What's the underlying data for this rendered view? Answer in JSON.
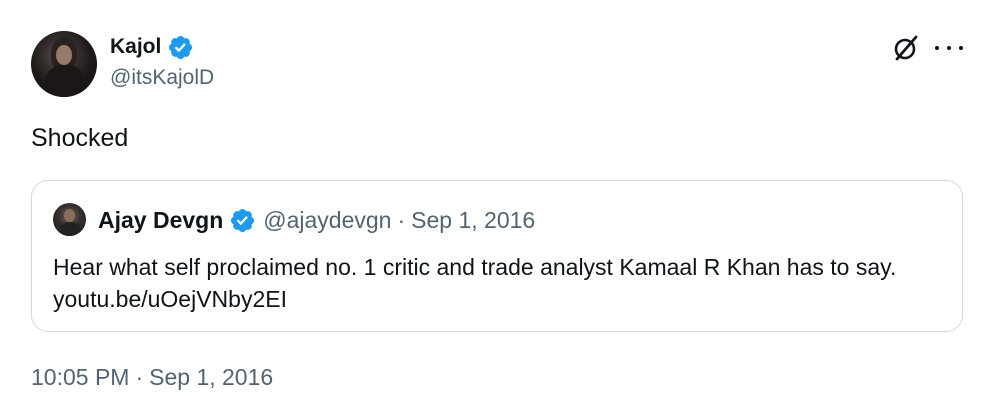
{
  "tweet": {
    "author": {
      "display_name": "Kajol",
      "handle": "@itsKajolD",
      "verified_icon": "verified-badge-icon",
      "avatar_icon": "avatar"
    },
    "text": "Shocked",
    "actions": {
      "grok_icon": "grok-icon",
      "more_icon": "more-options-icon"
    },
    "quote": {
      "author": {
        "display_name": "Ajay Devgn",
        "handle": "@ajaydevgn",
        "verified_icon": "verified-badge-icon"
      },
      "separator": "·",
      "date": "Sep 1, 2016",
      "text": "Hear what self proclaimed no. 1 critic and trade analyst Kamaal R Khan has to say. ",
      "link": "youtu.be/uOejVNby2EI"
    },
    "footer": {
      "time": "10:05 PM",
      "separator": "·",
      "date": "Sep 1, 2016"
    }
  },
  "colors": {
    "text": "#0f1419",
    "secondary": "#536471",
    "verified": "#1d9bf0",
    "border": "#cfd9de"
  }
}
